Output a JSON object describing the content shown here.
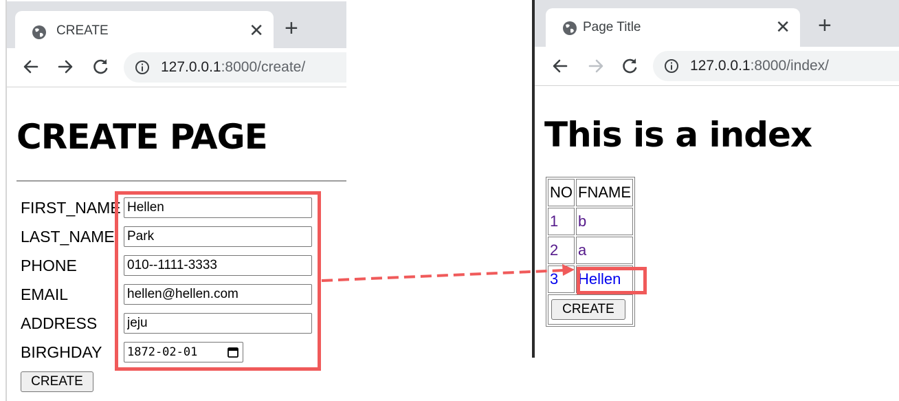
{
  "left_window": {
    "tab_title": "CREATE",
    "url_host": "127.0.0.1",
    "url_rest": ":8000/create/",
    "heading": "CREATE PAGE",
    "form": {
      "fields": [
        {
          "label": "FIRST_NAME",
          "value": "Hellen"
        },
        {
          "label": "LAST_NAME",
          "value": "Park"
        },
        {
          "label": "PHONE",
          "value": "010--1111-3333"
        },
        {
          "label": "EMAIL",
          "value": "hellen@hellen.com"
        },
        {
          "label": "ADDRESS",
          "value": "jeju"
        },
        {
          "label": "BIRGHDAY",
          "value": "1872-02-01"
        }
      ],
      "submit_label": "CREATE"
    }
  },
  "right_window": {
    "tab_title": "Page Title",
    "url_host": "127.0.0.1",
    "url_rest": ":8000/index/",
    "heading": "This is a index",
    "table": {
      "headers": [
        "NO",
        "FNAME"
      ],
      "rows": [
        {
          "no": "1",
          "fname": "b"
        },
        {
          "no": "2",
          "fname": "a"
        },
        {
          "no": "3",
          "fname": "Hellen"
        }
      ],
      "create_label": "CREATE"
    }
  },
  "annotation": {
    "highlight_color": "#f05a5a"
  },
  "icons": [
    "globe-icon",
    "close-icon",
    "new-tab-icon",
    "back-icon",
    "forward-icon",
    "reload-icon",
    "info-icon",
    "calendar-icon"
  ]
}
